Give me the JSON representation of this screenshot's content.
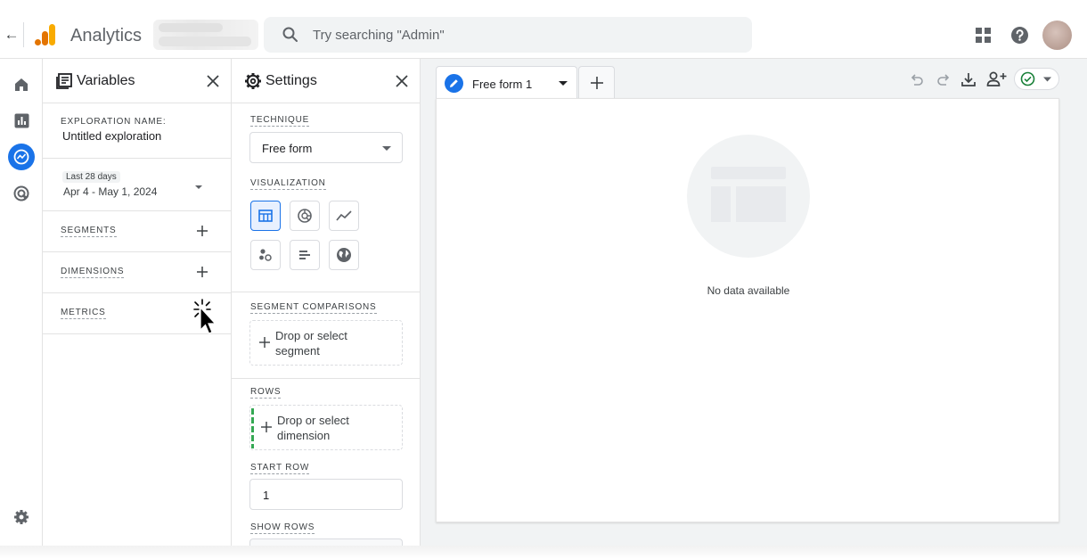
{
  "topbar": {
    "app_title": "Analytics",
    "search_placeholder": "Try searching \"Admin\""
  },
  "rail": {
    "items": [
      {
        "name": "Home",
        "icon": "home-icon"
      },
      {
        "name": "Reports",
        "icon": "bar-chart-icon"
      },
      {
        "name": "Explore",
        "icon": "explore-icon",
        "active": true
      },
      {
        "name": "Advertising",
        "icon": "advertising-icon"
      }
    ],
    "bottom_icon": "gear-icon"
  },
  "variables": {
    "title": "Variables",
    "exploration_label": "EXPLORATION NAME:",
    "exploration_name": "Untitled exploration",
    "date_chip": "Last 28 days",
    "date_range": "Apr 4 - May 1, 2024",
    "segments_label": "SEGMENTS",
    "dimensions_label": "DIMENSIONS",
    "metrics_label": "METRICS"
  },
  "settings": {
    "title": "Settings",
    "technique_label": "TECHNIQUE",
    "technique_value": "Free form",
    "visualization_label": "VISUALIZATION",
    "visualizations": [
      "table-icon",
      "donut-chart-icon",
      "line-chart-icon",
      "scatter-icon",
      "bar-chart-icon",
      "geo-map-icon"
    ],
    "segment_comparisons_label": "SEGMENT COMPARISONS",
    "segment_drop_text": "Drop or select segment",
    "rows_label": "ROWS",
    "rows_drop_text": "Drop or select dimension",
    "start_row_label": "START ROW",
    "start_row_value": "1",
    "show_rows_label": "SHOW ROWS"
  },
  "canvas": {
    "tab_label": "Free form 1",
    "empty_text": "No data available"
  },
  "colors": {
    "accent": "#1a73e8",
    "success": "#188038",
    "logo_orange": "#f9ab00",
    "logo_dark_orange": "#e37400",
    "rows_marker": "#34a853"
  }
}
